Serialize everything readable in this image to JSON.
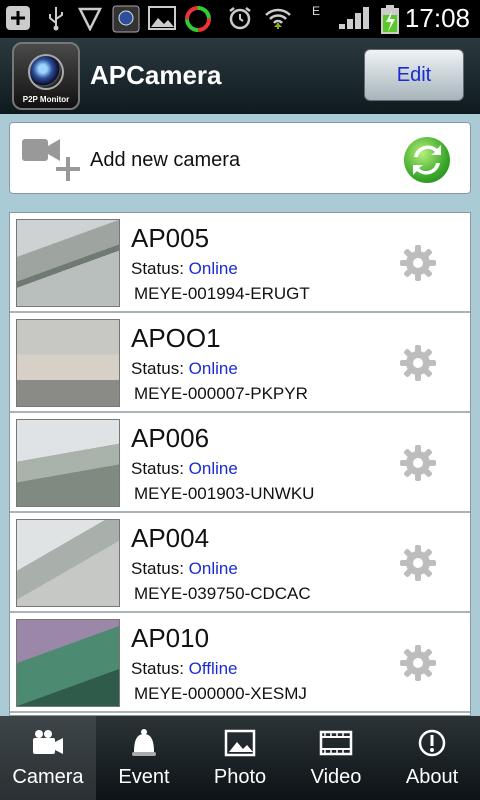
{
  "statusbar": {
    "time": "17:08",
    "network_letter": "E",
    "icons": [
      "add-icon",
      "usb-icon",
      "shield-icon",
      "camera-app-icon",
      "picture-icon",
      "sync-icon",
      "alarm-icon",
      "wifi-icon",
      "signal-icon",
      "battery-icon"
    ]
  },
  "header": {
    "app_title": "APCamera",
    "logo_caption": "P2P Monitor",
    "edit_label": "Edit"
  },
  "add_camera": {
    "label": "Add new camera"
  },
  "cameras": [
    {
      "name": "AP005",
      "status_label": "Status:",
      "status": "Online",
      "id": "MEYE-001994-ERUGT"
    },
    {
      "name": "APOO1",
      "status_label": "Status:",
      "status": "Online",
      "id": "MEYE-000007-PKPYR"
    },
    {
      "name": "AP006",
      "status_label": "Status:",
      "status": "Online",
      "id": "MEYE-001903-UNWKU"
    },
    {
      "name": "AP004",
      "status_label": "Status:",
      "status": "Online",
      "id": "MEYE-039750-CDCAC"
    },
    {
      "name": "AP010",
      "status_label": "Status:",
      "status": "Offline",
      "id": "MEYE-000000-XESMJ"
    }
  ],
  "nav": {
    "items": [
      {
        "label": "Camera",
        "icon": "camera-icon",
        "active": true
      },
      {
        "label": "Event",
        "icon": "bell-icon",
        "active": false
      },
      {
        "label": "Photo",
        "icon": "photo-icon",
        "active": false
      },
      {
        "label": "Video",
        "icon": "film-icon",
        "active": false
      },
      {
        "label": "About",
        "icon": "info-icon",
        "active": false
      }
    ]
  },
  "colors": {
    "accent_blue": "#1a2bd0",
    "background": "#aacbd6"
  }
}
